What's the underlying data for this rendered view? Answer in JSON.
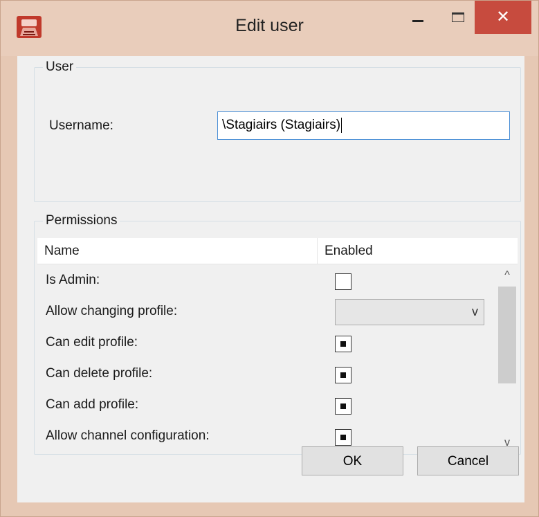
{
  "window": {
    "title": "Edit user",
    "icons": {
      "app": "app-icon",
      "minimize": "minimize-icon",
      "maximize": "maximize-icon",
      "close": "close-icon"
    },
    "close_glyph": "✕"
  },
  "user_group": {
    "label": "User",
    "username_label": "Username:",
    "username_value": "\\Stagiairs (Stagiairs)"
  },
  "permissions": {
    "label": "Permissions",
    "columns": [
      "Name",
      "Enabled"
    ],
    "rows": [
      {
        "label": "Is Admin:",
        "control": "checkbox",
        "state": "unchecked"
      },
      {
        "label": "Allow changing profile:",
        "control": "combobox",
        "value": ""
      },
      {
        "label": "Can edit profile:",
        "control": "checkbox",
        "state": "indeterminate"
      },
      {
        "label": "Can delete profile:",
        "control": "checkbox",
        "state": "indeterminate"
      },
      {
        "label": "Can add profile:",
        "control": "checkbox",
        "state": "indeterminate"
      },
      {
        "label": "Allow channel configuration:",
        "control": "checkbox",
        "state": "indeterminate"
      }
    ],
    "scroll_up_glyph": "^",
    "scroll_down_glyph": "v",
    "combo_arrow_glyph": "v"
  },
  "buttons": {
    "ok": "OK",
    "cancel": "Cancel"
  },
  "colors": {
    "titlebar": "#e9cdbb",
    "close_button": "#c74b3e",
    "input_focus_border": "#4a8fd6",
    "client_bg": "#f0f0f0"
  }
}
